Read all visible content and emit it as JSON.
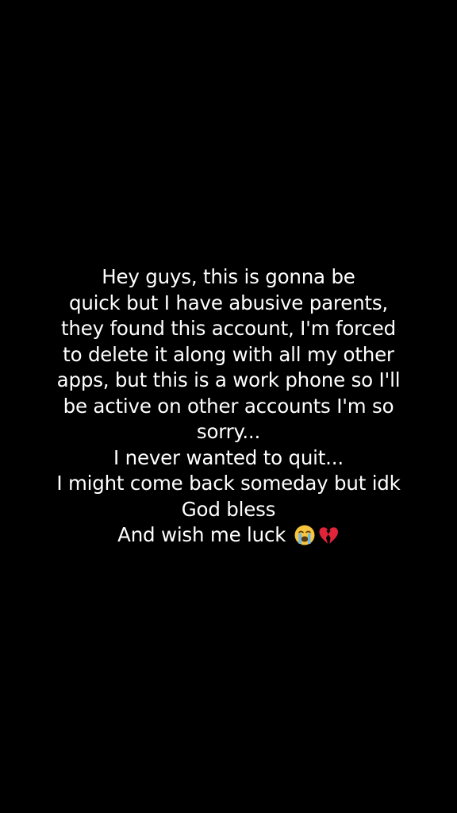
{
  "message": {
    "lines": [
      "Hey guys, this is gonna be",
      "quick but I have abusive parents,",
      "they found this account, I'm forced",
      "to delete it along with all my other",
      "apps, but this is a work phone so I'll",
      "be active on other accounts I'm so",
      "sorry...",
      "I never wanted to quit...",
      "I might come back someday but idk",
      "God bless",
      "And wish me luck"
    ],
    "emojis": [
      "loudly-crying-face-icon",
      "broken-heart-icon"
    ]
  },
  "colors": {
    "background": "#000000",
    "text": "#ffffff",
    "emoji_face": "#f7c53d",
    "emoji_tears": "#6fb7ea",
    "emoji_heart": "#e0243a"
  }
}
